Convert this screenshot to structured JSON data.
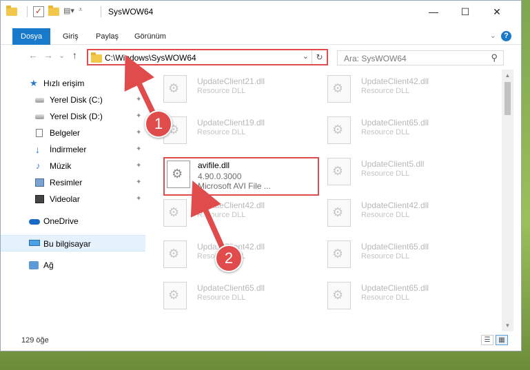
{
  "window": {
    "title": "SysWOW64",
    "minimize_glyph": "—",
    "maximize_glyph": "☐",
    "close_glyph": "✕"
  },
  "ribbon": {
    "tabs": [
      "Dosya",
      "Giriş",
      "Paylaş",
      "Görünüm"
    ],
    "help_label": "?"
  },
  "address": {
    "path": "C:\\Windows\\SysWOW64",
    "refresh_glyph": "↻"
  },
  "search": {
    "placeholder": "Ara: SysWOW64"
  },
  "nav": {
    "back": "←",
    "forward": "→",
    "recent": "⌄",
    "up": "↑",
    "items": [
      {
        "label": "Hızlı erişim",
        "icon": "star-icon"
      },
      {
        "label": "Yerel Disk (C:)",
        "icon": "drive-icon",
        "pinned": true
      },
      {
        "label": "Yerel Disk (D:)",
        "icon": "drive-icon",
        "pinned": true
      },
      {
        "label": "Belgeler",
        "icon": "documents-icon",
        "pinned": true
      },
      {
        "label": "İndirmeler",
        "icon": "downloads-icon",
        "pinned": true
      },
      {
        "label": "Müzik",
        "icon": "music-icon",
        "pinned": true
      },
      {
        "label": "Resimler",
        "icon": "pictures-icon",
        "pinned": true
      },
      {
        "label": "Videolar",
        "icon": "videos-icon",
        "pinned": true
      },
      {
        "label": "OneDrive",
        "icon": "onedrive-icon"
      },
      {
        "label": "Bu bilgisayar",
        "icon": "this-pc-icon",
        "selected": true
      },
      {
        "label": "Ağ",
        "icon": "network-icon"
      }
    ],
    "pin_glyph": "📌"
  },
  "files": [
    {
      "name": "UpdateClient21.dll",
      "sub": "Resource DLL"
    },
    {
      "name": "UpdateClient42.dll",
      "sub": "Resource DLL"
    },
    {
      "name": "UpdateClient19.dll",
      "sub": "Resource DLL"
    },
    {
      "name": "UpdateClient65.dll",
      "sub": "Resource DLL"
    },
    {
      "name": "avifile.dll",
      "sub": "4.90.0.3000",
      "sub2": "Microsoft AVI File ...",
      "highlighted": true
    },
    {
      "name": "UpdateClient5.dll",
      "sub": "Resource DLL"
    },
    {
      "name": "UpdateClient42.dll",
      "sub": "Resource DLL"
    },
    {
      "name": "UpdateClient42.dll",
      "sub": "Resource DLL"
    },
    {
      "name": "UpdateClient42.dll",
      "sub": "Resource DLL"
    },
    {
      "name": "UpdateClient65.dll",
      "sub": "Resource DLL"
    },
    {
      "name": "UpdateClient65.dll",
      "sub": "Resource DLL"
    },
    {
      "name": "UpdateClient65.dll",
      "sub": "Resource DLL"
    }
  ],
  "status": {
    "count": "129 öğe"
  },
  "annotations": {
    "badge1": "1",
    "badge2": "2",
    "color": "#e04b4b"
  }
}
